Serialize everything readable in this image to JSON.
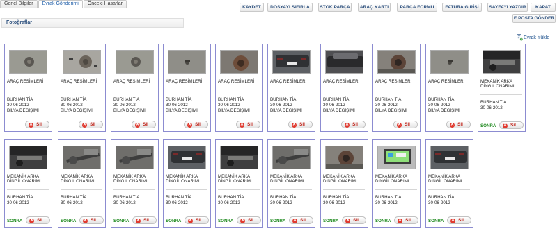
{
  "tabs": [
    {
      "label": "Genel Bilgiler",
      "active": false
    },
    {
      "label": "Evrak Gönderimi",
      "active": true
    },
    {
      "label": "Önceki Hasarlar",
      "active": false
    }
  ],
  "toolbar": {
    "kaydet": "KAYDET",
    "dosyayi_sifirla": "DOSYAYI SIFIRLA",
    "stok_parca": "STOK PARÇA",
    "arac_karti": "ARAÇ KARTI",
    "parca_formu": "PARÇA FORMU",
    "fatura_girisi": "FATURA GİRİŞİ",
    "sayfayi_yazdir": "SAYFAYI YAZDIR",
    "kapat": "KAPAT",
    "eposta_gonder": "E.POSTA GÖNDER"
  },
  "section": {
    "title": "Fotoğraflar"
  },
  "upload": {
    "label": "Evrak Yükle",
    "icon": "document-upload-icon"
  },
  "delete_label": "Sil",
  "later_label": "SONRA",
  "row1": [
    {
      "category": "ARAÇ RESİMLERİ",
      "user": "BURHAN TİA",
      "date": "30-06-2012",
      "note": "BİLYA DEĞİŞİMİ",
      "photo": "brake-disc"
    },
    {
      "category": "ARAÇ RESİMLERİ",
      "user": "BURHAN TİA",
      "date": "30-06-2012",
      "note": "BİLYA DEĞİŞİMİ",
      "photo": "disc-parts"
    },
    {
      "category": "ARAÇ RESİMLERİ",
      "user": "BURHAN TİA",
      "date": "30-06-2012",
      "note": "BİLYA DEĞİŞİMİ",
      "photo": "brake-disc"
    },
    {
      "category": "ARAÇ RESİMLERİ",
      "user": "BURHAN TİA",
      "date": "30-06-2012",
      "note": "BİLYA DEĞİŞİMİ",
      "photo": "floor-part"
    },
    {
      "category": "ARAÇ RESİMLERİ",
      "user": "BURHAN TİA",
      "date": "30-06-2012",
      "note": "BİLYA DEĞİŞİMİ",
      "photo": "rusty-disc"
    },
    {
      "category": "ARAÇ RESİMLERİ",
      "user": "BURHAN TİA",
      "date": "30-06-2012",
      "note": "BİLYA DEĞİŞİMİ",
      "photo": "car-rear"
    },
    {
      "category": "ARAÇ RESİMLERİ",
      "user": "BURHAN TİA",
      "date": "30-06-2012",
      "note": "BİLYA DEĞİŞİMİ",
      "photo": "car-side"
    },
    {
      "category": "ARAÇ RESİMLERİ",
      "user": "BURHAN TİA",
      "date": "30-06-2012",
      "note": "BİLYA DEĞİŞİMİ",
      "photo": "wheel-hub"
    },
    {
      "category": "ARAÇ RESİMLERİ",
      "user": "BURHAN TİA",
      "date": "30-06-2012",
      "note": "BİLYA DEĞİŞİMİ",
      "photo": "floor-part"
    }
  ],
  "row1_last": {
    "category_line1": "MEKANİK ARKA",
    "category_line2": "DİNGİL ONARIMI",
    "user": "BURHAN TİA",
    "date": "30-06-2012",
    "photo": "under-car"
  },
  "row2": [
    {
      "category_line1": "MEKANİK ARKA",
      "category_line2": "DİNGİL ONARIMI",
      "user": "BURHAN TİA",
      "date": "30-06-2012",
      "photo": "under-car"
    },
    {
      "category_line1": "MEKANİK ARKA",
      "category_line2": "DİNGİL ONARIMI",
      "user": "BURHAN TİA",
      "date": "30-06-2012",
      "photo": "axle"
    },
    {
      "category_line1": "MEKANİK ARKA",
      "category_line2": "DİNGİL ONARIMI",
      "user": "BURHAN TİA",
      "date": "30-06-2012",
      "photo": "axle"
    },
    {
      "category_line1": "MEKANİK ARKA",
      "category_line2": "DİNGİL ONARIMI",
      "user": "BURHAN TİA",
      "date": "30-06-2012",
      "photo": "car-rear"
    },
    {
      "category_line1": "MEKANİK ARKA",
      "category_line2": "DİNGİL ONARIMI",
      "user": "BURHAN TİA",
      "date": "30-06-2012",
      "photo": "under-car"
    },
    {
      "category_line1": "MEKANİK ARKA",
      "category_line2": "DİNGİL ONARIMI",
      "user": "BURHAN TİA",
      "date": "30-06-2012",
      "photo": "axle"
    },
    {
      "category_line1": "MEKANİK ARKA",
      "category_line2": "DİNGİL ONARIMI",
      "user": "BURHAN TİA",
      "date": "30-06-2012",
      "photo": "wheel-hub"
    },
    {
      "category_line1": "MEKANİK ARKA",
      "category_line2": "DİNGİL ONARIMI",
      "user": "BURHAN TİA",
      "date": "30-06-2012",
      "photo": "monitor"
    },
    {
      "category_line1": "MEKANİK ARKA",
      "category_line2": "DİNGİL ONARIMI",
      "user": "BURHAN TİA",
      "date": "30-06-2012",
      "photo": "car-rear"
    }
  ]
}
